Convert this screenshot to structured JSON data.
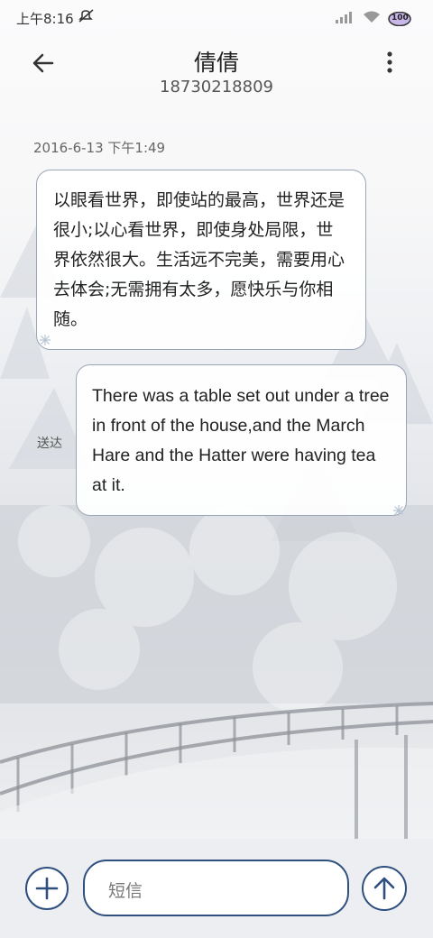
{
  "status_bar": {
    "time": "上午8:16",
    "battery": "100"
  },
  "header": {
    "contact_name": "倩倩",
    "phone_number": "18730218809"
  },
  "conversation": {
    "timestamp": "2016-6-13 下午1:49",
    "messages": [
      {
        "direction": "incoming",
        "text": "以眼看世界，即使站的最高，世界还是很小;以心看世界，即使身处局限，世界依然很大。生活远不完美，需要用心去体会;无需拥有太多，愿快乐与你相随。"
      },
      {
        "direction": "outgoing",
        "text": "There was a table set out under a tree in front of the house,and the March Hare and the Hatter were having tea at it.",
        "status": "送达"
      }
    ]
  },
  "composer": {
    "placeholder": "短信"
  },
  "icons": {
    "back": "back-arrow-icon",
    "more": "more-vert-icon",
    "add": "plus-icon",
    "send": "arrow-up-icon"
  },
  "colors": {
    "accent": "#2f4f7f",
    "bubble_border": "#9aa6b8"
  }
}
